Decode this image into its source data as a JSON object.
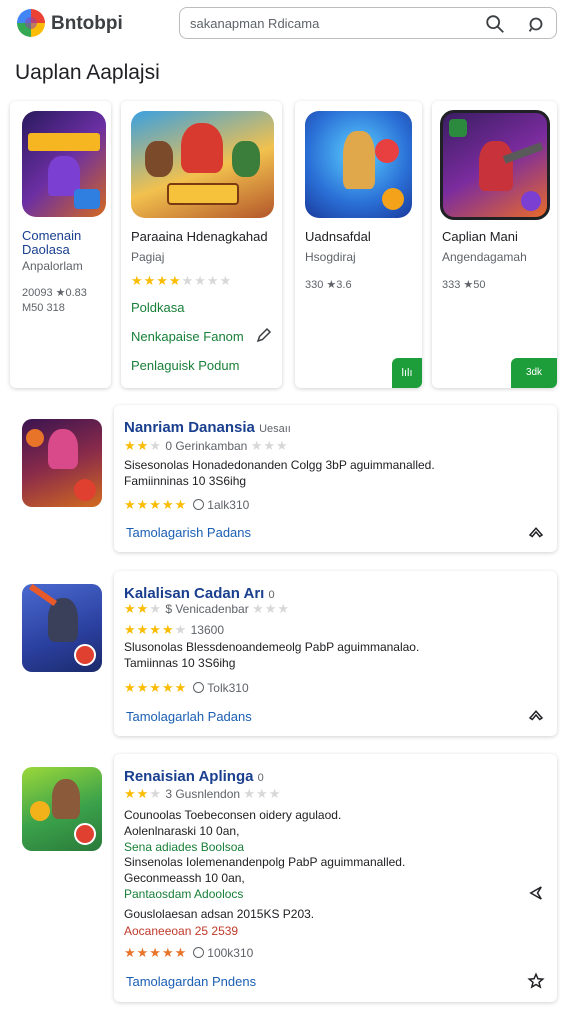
{
  "header": {
    "app_name": "Bntobpi",
    "search_placeholder": "sakanapman Rdicama"
  },
  "section_title": "Uaplan Aaplajsi",
  "top_cards": [
    {
      "title": "Comenain Daolasa",
      "subtitle": "Anpalorlam",
      "meta": "20093 ★0.83 M50 318"
    },
    {
      "title": "Paraaina Hdenagkahad",
      "subtitle": "Pagiaj",
      "rating": 4,
      "green1": "Poldkasa",
      "green2": "Nenkapaise Fanom",
      "green3": "Penlaguisk Podum"
    },
    {
      "title": "Uadnsafdal",
      "subtitle": "Hsogdiraj",
      "meta": "330 ★3.6",
      "badge": "lılı"
    },
    {
      "title": "Caplian Mani",
      "subtitle": "Angendagamah",
      "meta": "333 ★50",
      "badge": "3dk"
    }
  ],
  "list_cards": [
    {
      "title": "Nanriam Danansia",
      "title_suffix": "Uesaıı",
      "rating_text": "0 Gerinkamban",
      "line1": "Sisesonolas Honadedonanden Colgg 3bP aguimmanalled.",
      "line2": "Famiinninas 10 3S6ihg",
      "rating_count": "1alk310",
      "link": "Tamolagarish Padans"
    },
    {
      "title": "Kalalisan Cadan Arı",
      "title_suffix": "0",
      "rating_text": "$ Venicadenbar",
      "rating_count2": "13600",
      "line1": "Slusonolas Blessdenoandemeolg PabP aguimmanalao.",
      "line2": "Tamiinnas 10 3S6ihg",
      "rating_count": "Tolk310",
      "link": "Tamolagarlah Padans"
    },
    {
      "title": "Renaisian Aplinga",
      "title_suffix": "0",
      "rating_text": "3 Gusnlendon",
      "lines": [
        "Counoolas Toebeconsen oidery agulaod.",
        "Aolenlnaraski 10 0an,",
        "Sena adiades Boolsoa",
        "Sinsenolas Iolemenandenpolg PabP aguimmanalled.",
        "Geconmeassh 10 0an,",
        "Pantaosdam Adoolocs",
        "Gouslolaesan adsan 2015KS P203.",
        "Aocaneeoan 25 2539"
      ],
      "rating_count": "100k310",
      "link": "Tamolagardan Pndens"
    }
  ]
}
